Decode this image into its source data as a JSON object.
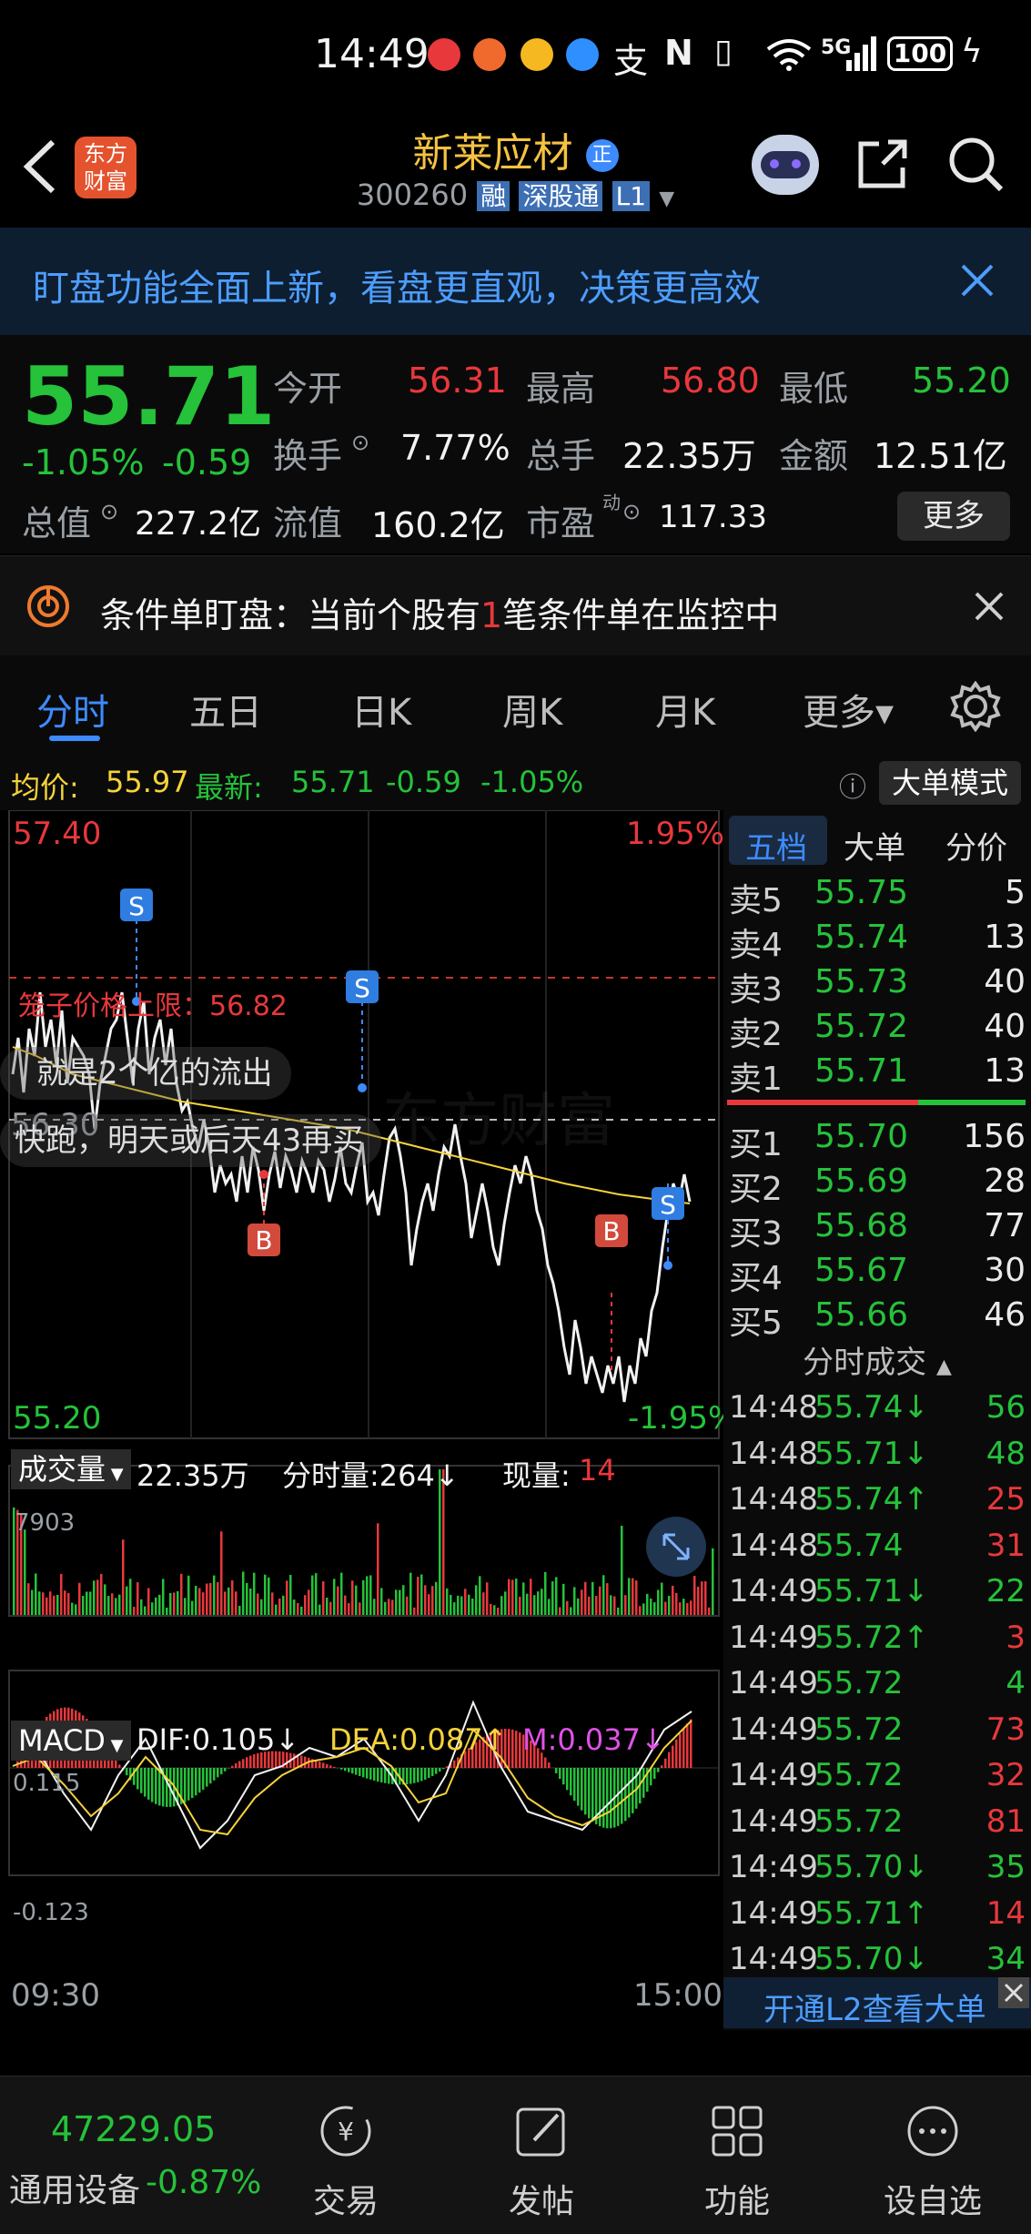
{
  "status_bar": {
    "time": "14:49",
    "signal": "5G",
    "battery": "100"
  },
  "header": {
    "logo_line1": "东方",
    "logo_line2": "财富",
    "stock_name": "新莱应材",
    "stock_code": "300260",
    "badge_rong": "融",
    "badge_exchange": "深股通",
    "badge_level": "L1"
  },
  "banner": {
    "text": "盯盘功能全面上新，看盘更直观，决策更高效"
  },
  "quote": {
    "price": "55.71",
    "change_pct": "-1.05%",
    "change": "-0.59",
    "open_label": "今开",
    "open": "56.31",
    "high_label": "最高",
    "high": "56.80",
    "low_label": "最低",
    "low": "55.20",
    "turnover_label": "换手",
    "turnover": "7.77%",
    "volume_label": "总手",
    "volume": "22.35万",
    "amount_label": "金额",
    "amount": "12.51亿",
    "mktcap_label": "总值",
    "mktcap": "227.2亿",
    "float_label": "流值",
    "float": "160.2亿",
    "pe_label": "市盈",
    "pe_sup": "动",
    "pe": "117.33",
    "more_button": "更多"
  },
  "alert": {
    "prefix": "条件单盯盘：当前个股有",
    "count": "1",
    "suffix": "笔条件单在监控中"
  },
  "tabs": [
    "分时",
    "五日",
    "日K",
    "周K",
    "月K",
    "更多▾"
  ],
  "avg_line": {
    "avg_label": "均价:",
    "avg": "55.97",
    "latest_label": "最新:",
    "latest": "55.71",
    "chg": "-0.59",
    "pct": "-1.05%",
    "bigorder_button": "大单模式"
  },
  "chart": {
    "top_price": "57.40",
    "top_pct": "1.95%",
    "bottom_price": "55.20",
    "bottom_pct": "-1.95%",
    "mid_price": "56.30",
    "limit_label": "笼子价格上限：56.82",
    "comment1": "就是2个亿的流出",
    "comment2": "快跑，明天或后天43再买",
    "marker_s": "S",
    "marker_b": "B",
    "watermark": "东方财富",
    "time_start": "09:30",
    "time_end": "15:00"
  },
  "volume_panel": {
    "selector": "成交量",
    "total": "22.35万",
    "tick_vol_label": "分时量:264↓",
    "cur_label": "现量:",
    "cur": "14",
    "max": "7903"
  },
  "macd_panel": {
    "selector": "MACD",
    "dif": "DIF:0.105↓",
    "dea": "DEA:0.087↑",
    "m": "M:0.037↓",
    "top": "0.115",
    "bottom": "-0.123"
  },
  "orderbook": {
    "tabs": [
      "五档",
      "大单",
      "分价"
    ],
    "sells": [
      {
        "label": "卖5",
        "price": "55.75",
        "vol": "5"
      },
      {
        "label": "卖4",
        "price": "55.74",
        "vol": "13"
      },
      {
        "label": "卖3",
        "price": "55.73",
        "vol": "40"
      },
      {
        "label": "卖2",
        "price": "55.72",
        "vol": "40"
      },
      {
        "label": "卖1",
        "price": "55.71",
        "vol": "13"
      }
    ],
    "buys": [
      {
        "label": "买1",
        "price": "55.70",
        "vol": "156"
      },
      {
        "label": "买2",
        "price": "55.69",
        "vol": "28"
      },
      {
        "label": "买3",
        "price": "55.68",
        "vol": "77"
      },
      {
        "label": "买4",
        "price": "55.67",
        "vol": "30"
      },
      {
        "label": "买5",
        "price": "55.66",
        "vol": "46"
      }
    ]
  },
  "trades": {
    "title": "分时成交",
    "rows": [
      {
        "time": "14:48",
        "price": "55.74↓",
        "vol": "56"
      },
      {
        "time": "14:48",
        "price": "55.71↓",
        "vol": "48"
      },
      {
        "time": "14:48",
        "price": "55.74↑",
        "vol": "25"
      },
      {
        "time": "14:48",
        "price": "55.74",
        "vol": "31"
      },
      {
        "time": "14:49",
        "price": "55.71↓",
        "vol": "22"
      },
      {
        "time": "14:49",
        "price": "55.72↑",
        "vol": "3"
      },
      {
        "time": "14:49",
        "price": "55.72",
        "vol": "4"
      },
      {
        "time": "14:49",
        "price": "55.72",
        "vol": "73"
      },
      {
        "time": "14:49",
        "price": "55.72",
        "vol": "32"
      },
      {
        "time": "14:49",
        "price": "55.72",
        "vol": "81"
      },
      {
        "time": "14:49",
        "price": "55.70↓",
        "vol": "35"
      },
      {
        "time": "14:49",
        "price": "55.71↑",
        "vol": "14"
      },
      {
        "time": "14:49",
        "price": "55.70↓",
        "vol": "34"
      }
    ],
    "l2_link": "开通L2查看大单"
  },
  "bottom": {
    "index_value": "47229.05",
    "index_name": "通用设备",
    "index_pct": "-0.87%",
    "nav": [
      "交易",
      "发帖",
      "功能",
      "设自选"
    ]
  },
  "colors": {
    "up": "#e8383c",
    "down": "#25c23a",
    "avg_line": "#f5d33a",
    "accent": "#3d8bff"
  }
}
